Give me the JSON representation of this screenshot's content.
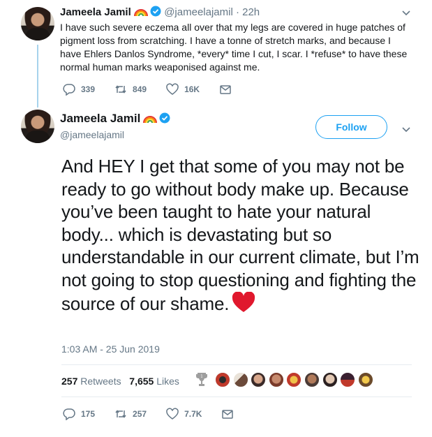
{
  "reply_tweet": {
    "name": "Jameela Jamil",
    "handle_time": "@jameelajamil · 22h",
    "text": "I have such severe eczema all over that my legs are covered in huge patches of pigment loss from scratching. I have a tonne of stretch marks, and because I have Ehlers Danlos Syndrome, *every* time I cut, I scar. I *refuse* to have these normal human marks weaponised against me.",
    "replies": "339",
    "retweets": "849",
    "likes": "16K"
  },
  "main_tweet": {
    "name": "Jameela Jamil",
    "handle": "@jameelajamil",
    "follow_label": "Follow",
    "text": "And HEY I get that some of you may not be ready to go without body make up. Because you’ve been taught to hate your natural body... which is devastating but so understandable in our current climate, but I’m not going to stop questioning and fighting the source of our shame.",
    "timestamp": "1:03 AM - 25 Jun 2019",
    "retweet_count": "257",
    "retweet_label": "Retweets",
    "like_count": "7,655",
    "like_label": "Likes",
    "replies": "175",
    "retweets": "257",
    "likes": "7.7K"
  },
  "icons": {
    "verified_color": "#1da1f2",
    "emoji": [
      "rainbow",
      "red-heart"
    ]
  },
  "liker_avatar_colors": [
    "#2b2b2b",
    "#8a6b5a",
    "#b08b78",
    "#6b4a3a",
    "#c07a2a",
    "#7a5a4a",
    "#5a4a45",
    "#3a2a3a",
    "#8a6a3a"
  ]
}
